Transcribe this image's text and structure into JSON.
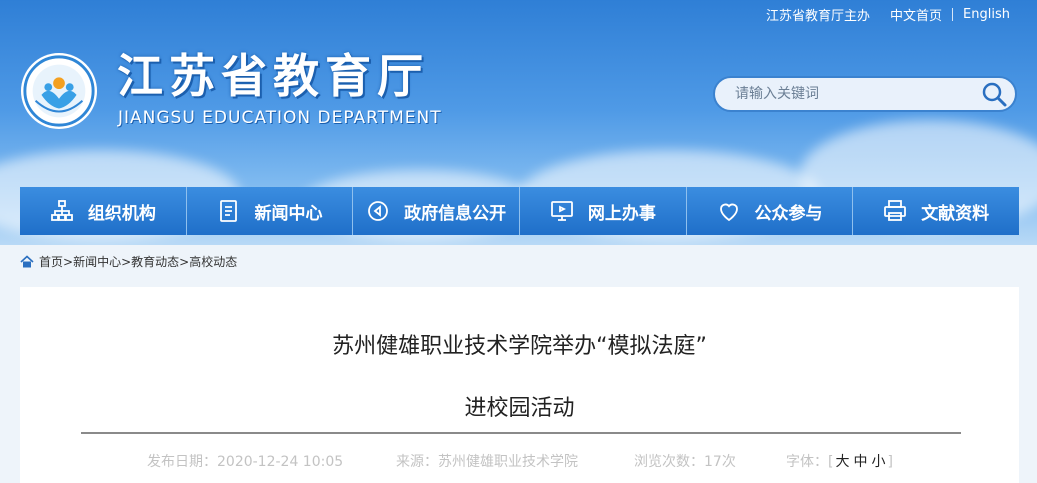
{
  "topbar": {
    "host": "江苏省教育厅主办",
    "home": "中文首页",
    "english": "English"
  },
  "site": {
    "title": "江苏省教育厅",
    "subtitle": "JIANGSU EDUCATION DEPARTMENT"
  },
  "search": {
    "placeholder": "请输入关键词"
  },
  "nav": {
    "items": [
      {
        "label": "组织机构",
        "icon": "org-chart-icon"
      },
      {
        "label": "新闻中心",
        "icon": "document-icon"
      },
      {
        "label": "政府信息公开",
        "icon": "announcement-icon"
      },
      {
        "label": "网上办事",
        "icon": "monitor-icon"
      },
      {
        "label": "公众参与",
        "icon": "heart-icon"
      },
      {
        "label": "文献资料",
        "icon": "printer-icon"
      }
    ]
  },
  "breadcrumb": {
    "items": [
      "首页",
      "新闻中心",
      "教育动态",
      "高校动态"
    ],
    "separator": ">"
  },
  "article": {
    "title_line1": "苏州健雄职业技术学院举办“模拟法庭”",
    "title_line2": "进校园活动",
    "date_label": "发布日期：2020-12-24 10:05",
    "source_label": "来源：苏州健雄职业技术学院",
    "views_label": "浏览次数：17次",
    "font_label": "字体：",
    "font_sizes": [
      "大",
      "中",
      "小"
    ]
  },
  "colors": {
    "nav_bg": "#2a7ad3",
    "banner_top": "#2f7fd6"
  }
}
